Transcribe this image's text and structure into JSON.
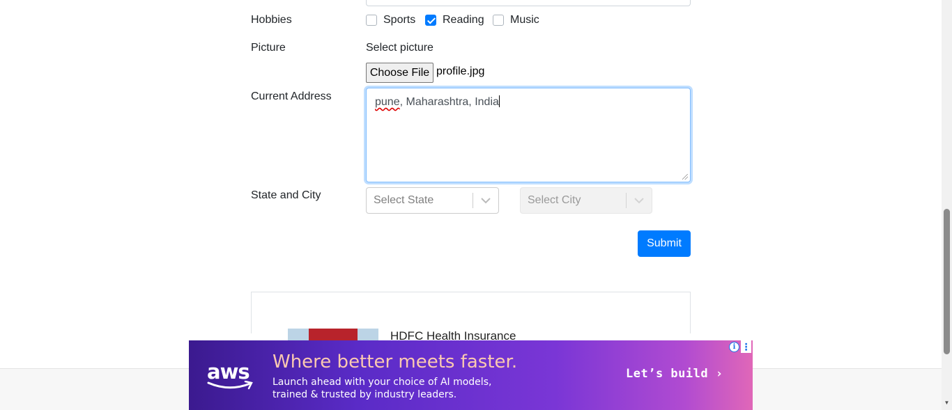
{
  "form": {
    "hobbies": {
      "label": "Hobbies",
      "options": [
        {
          "label": "Sports",
          "checked": false
        },
        {
          "label": "Reading",
          "checked": true
        },
        {
          "label": "Music",
          "checked": false
        }
      ]
    },
    "picture": {
      "label": "Picture",
      "select_text": "Select picture",
      "button_label": "Choose File",
      "file_name": "profile.jpg"
    },
    "address": {
      "label": "Current Address",
      "value_misspelled": "pune",
      "value_rest": ", Maharashtra, India"
    },
    "state_city": {
      "label": "State and City",
      "state_placeholder": "Select State",
      "city_placeholder": "Select City"
    },
    "submit_label": "Submit"
  },
  "ad_card": {
    "title": "HDFC Health Insurance"
  },
  "banner": {
    "brand": "aws",
    "headline": "Where better meets faster.",
    "subline_1": "Launch ahead with your choice of AI models,",
    "subline_2": "trained & trusted by industry leaders.",
    "cta": "Let’s build ›",
    "info_icon": "i",
    "menu_icon": "⋮"
  },
  "colors": {
    "primary": "#007bff",
    "banner_start": "#3b1a8f",
    "banner_end": "#e067b8",
    "headline": "#fbc9b1"
  }
}
